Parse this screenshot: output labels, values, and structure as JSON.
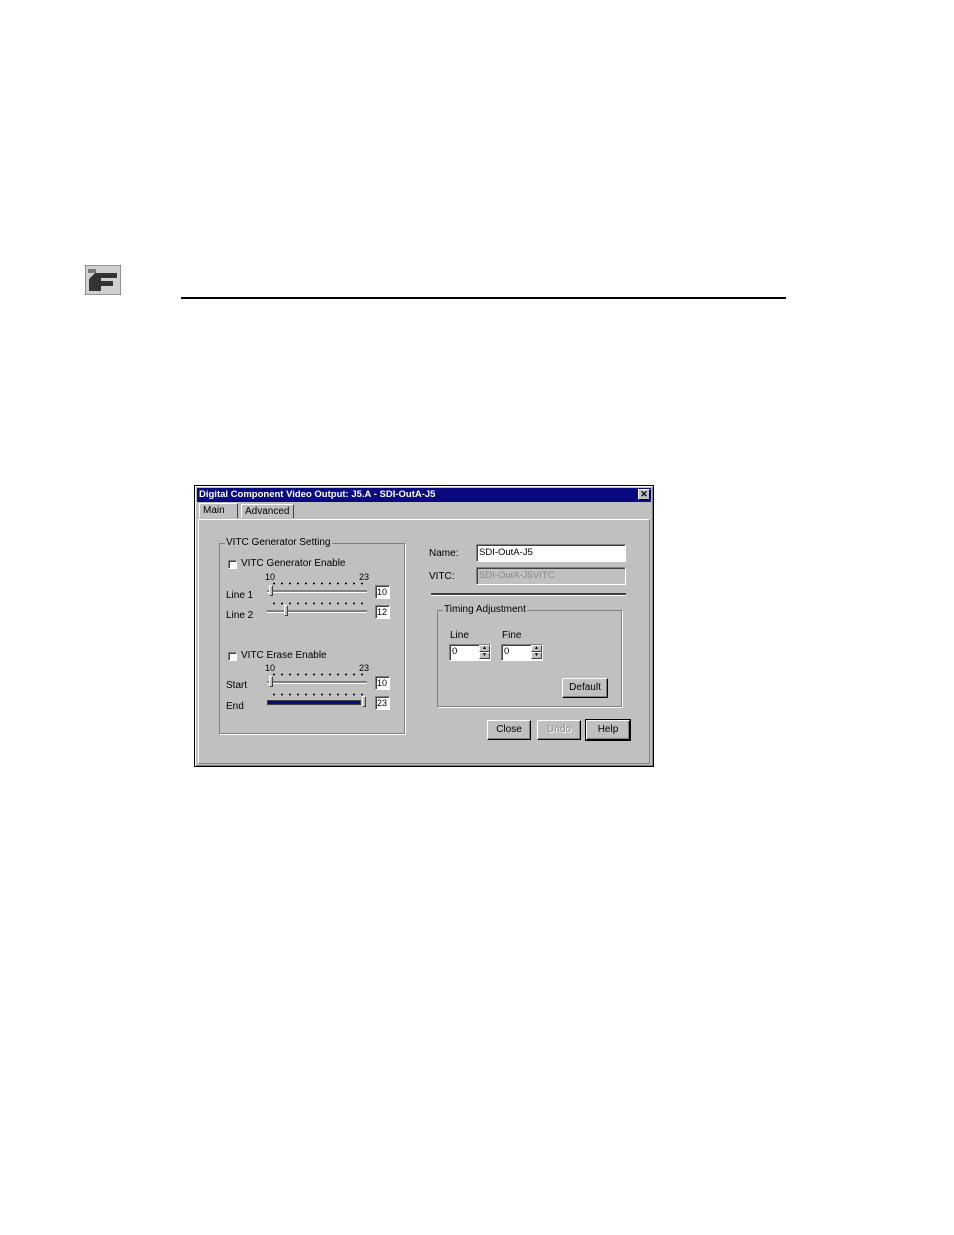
{
  "dialog": {
    "title": "Digital Component Video Output: J5.A - SDI-OutA-J5",
    "close_glyph": "✕"
  },
  "tabs": [
    {
      "label": "Main",
      "active": true
    },
    {
      "label": "Advanced",
      "active": false
    }
  ],
  "vitc_generator": {
    "group_label": "VITC Generator Setting",
    "enable_label": "VITC Generator Enable",
    "enable_checked": false,
    "range_min_label": "10",
    "range_max_label": "23",
    "line1": {
      "label": "Line 1",
      "value": "10"
    },
    "line2": {
      "label": "Line 2",
      "value": "12"
    },
    "erase_enable_label": "VITC Erase Enable",
    "erase_enable_checked": false,
    "erase_range_min_label": "10",
    "erase_range_max_label": "23",
    "start": {
      "label": "Start",
      "value": "10"
    },
    "end": {
      "label": "End",
      "value": "23"
    }
  },
  "fields": {
    "name_label": "Name:",
    "name_value": "SDI-OutA-J5",
    "vitc_label": "VITC:",
    "vitc_value": "SDI-OutA-J5VITC"
  },
  "timing": {
    "group_label": "Timing Adjustment",
    "line_label": "Line",
    "line_value": "0",
    "fine_label": "Fine",
    "fine_value": "0",
    "default_button": "Default"
  },
  "buttons": {
    "close": "Close",
    "undo": "Undo",
    "help": "Help"
  },
  "colors": {
    "titlebar": "#0a0a80",
    "face": "#c0c0c0"
  }
}
